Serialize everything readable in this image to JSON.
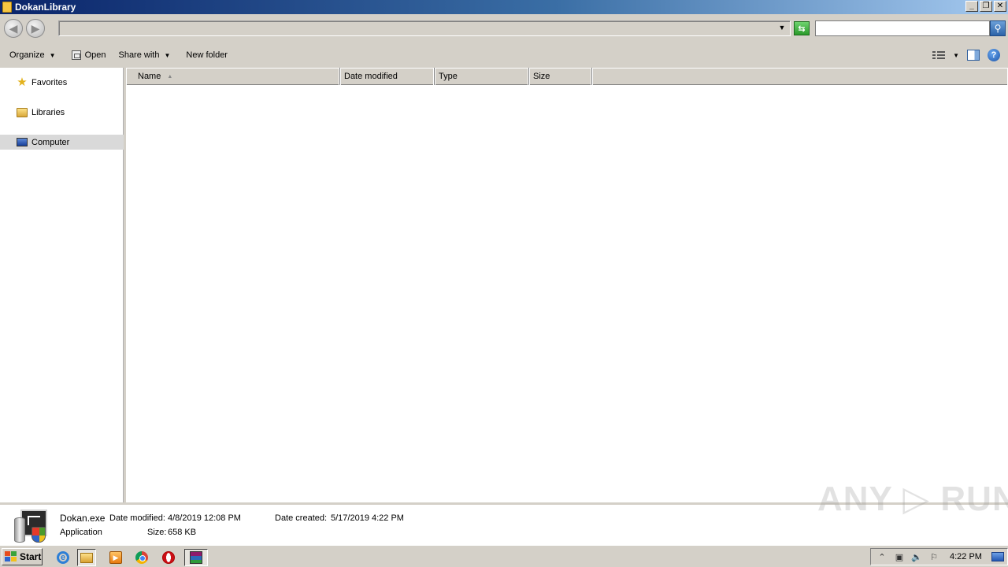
{
  "window": {
    "title": "DokanLibrary"
  },
  "address_bar": {
    "path": "",
    "search_placeholder": ""
  },
  "toolbar": {
    "organize_label": "Organize",
    "open_label": "Open",
    "share_with_label": "Share with",
    "new_folder_label": "New folder"
  },
  "nav_pane": {
    "items": [
      {
        "label": "Favorites",
        "icon": "star-icon"
      },
      {
        "label": "Libraries",
        "icon": "libraries-icon"
      },
      {
        "label": "Computer",
        "icon": "computer-icon",
        "selected": true
      }
    ]
  },
  "file_list": {
    "columns": [
      "Name",
      "Date modified",
      "Type",
      "Size"
    ],
    "sorted_by": "Name",
    "rows": []
  },
  "details_pane": {
    "file_name": "Dokan.exe",
    "file_type": "Application",
    "date_modified_label": "Date modified:",
    "date_modified": "4/8/2019 12:08 PM",
    "size_label": "Size:",
    "size": "658 KB",
    "date_created_label": "Date created:",
    "date_created": "5/17/2019 4:22 PM"
  },
  "watermark": "ANY ▷ RUN",
  "taskbar": {
    "start_label": "Start",
    "apps": [
      "internet-explorer-icon",
      "windows-explorer-icon",
      "media-player-icon",
      "chrome-icon",
      "opera-icon",
      "winrar-icon"
    ],
    "clock": "4:22 PM"
  }
}
